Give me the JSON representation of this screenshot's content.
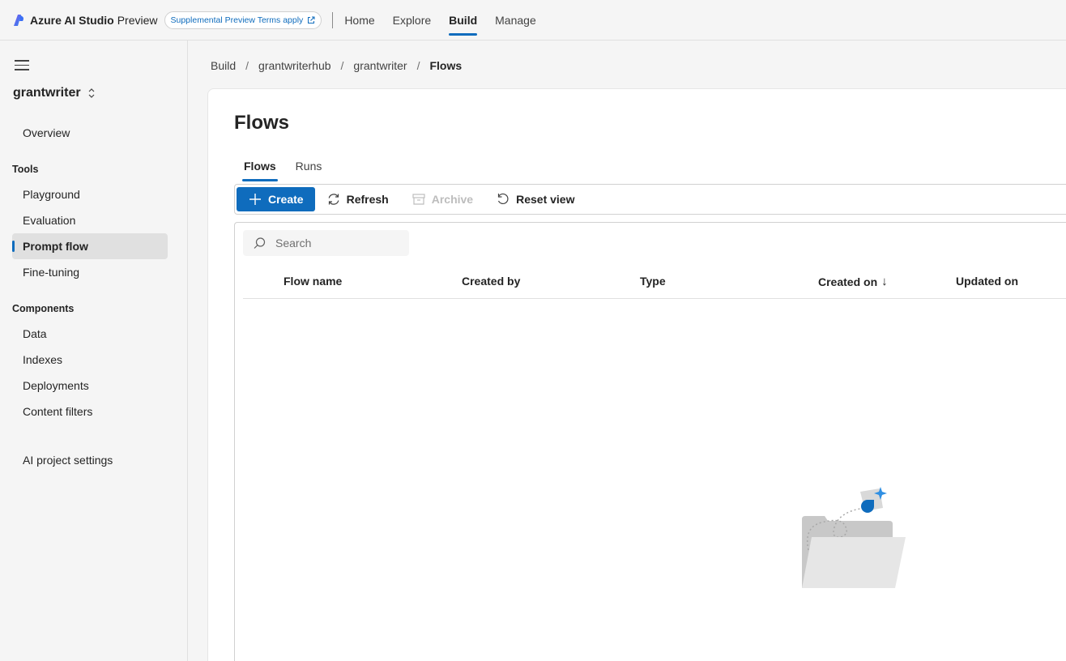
{
  "topbar": {
    "brand_name": "Azure AI Studio",
    "brand_suffix": "Preview",
    "terms_pill": "Supplemental Preview Terms apply",
    "nav": [
      {
        "label": "Home",
        "active": false
      },
      {
        "label": "Explore",
        "active": false
      },
      {
        "label": "Build",
        "active": true
      },
      {
        "label": "Manage",
        "active": false
      }
    ]
  },
  "sidebar": {
    "project_name": "grantwriter",
    "overview": "Overview",
    "tools_heading": "Tools",
    "tools": [
      "Playground",
      "Evaluation",
      "Prompt flow",
      "Fine-tuning"
    ],
    "active_item": "Prompt flow",
    "components_heading": "Components",
    "components": [
      "Data",
      "Indexes",
      "Deployments",
      "Content filters"
    ],
    "settings": "AI project settings"
  },
  "breadcrumb": [
    "Build",
    "grantwriterhub",
    "grantwriter",
    "Flows"
  ],
  "page": {
    "title": "Flows",
    "tabs": [
      {
        "label": "Flows",
        "active": true
      },
      {
        "label": "Runs",
        "active": false
      }
    ],
    "toolbar": {
      "create": "Create",
      "refresh": "Refresh",
      "archive": "Archive",
      "reset_view": "Reset view"
    },
    "search_placeholder": "Search",
    "columns": [
      "Flow name",
      "Created by",
      "Type",
      "Created on",
      "Updated on"
    ],
    "sort_indicator": "↓"
  },
  "colors": {
    "accent": "#0f6cbd",
    "background": "#f5f5f5",
    "panel": "#ffffff"
  }
}
